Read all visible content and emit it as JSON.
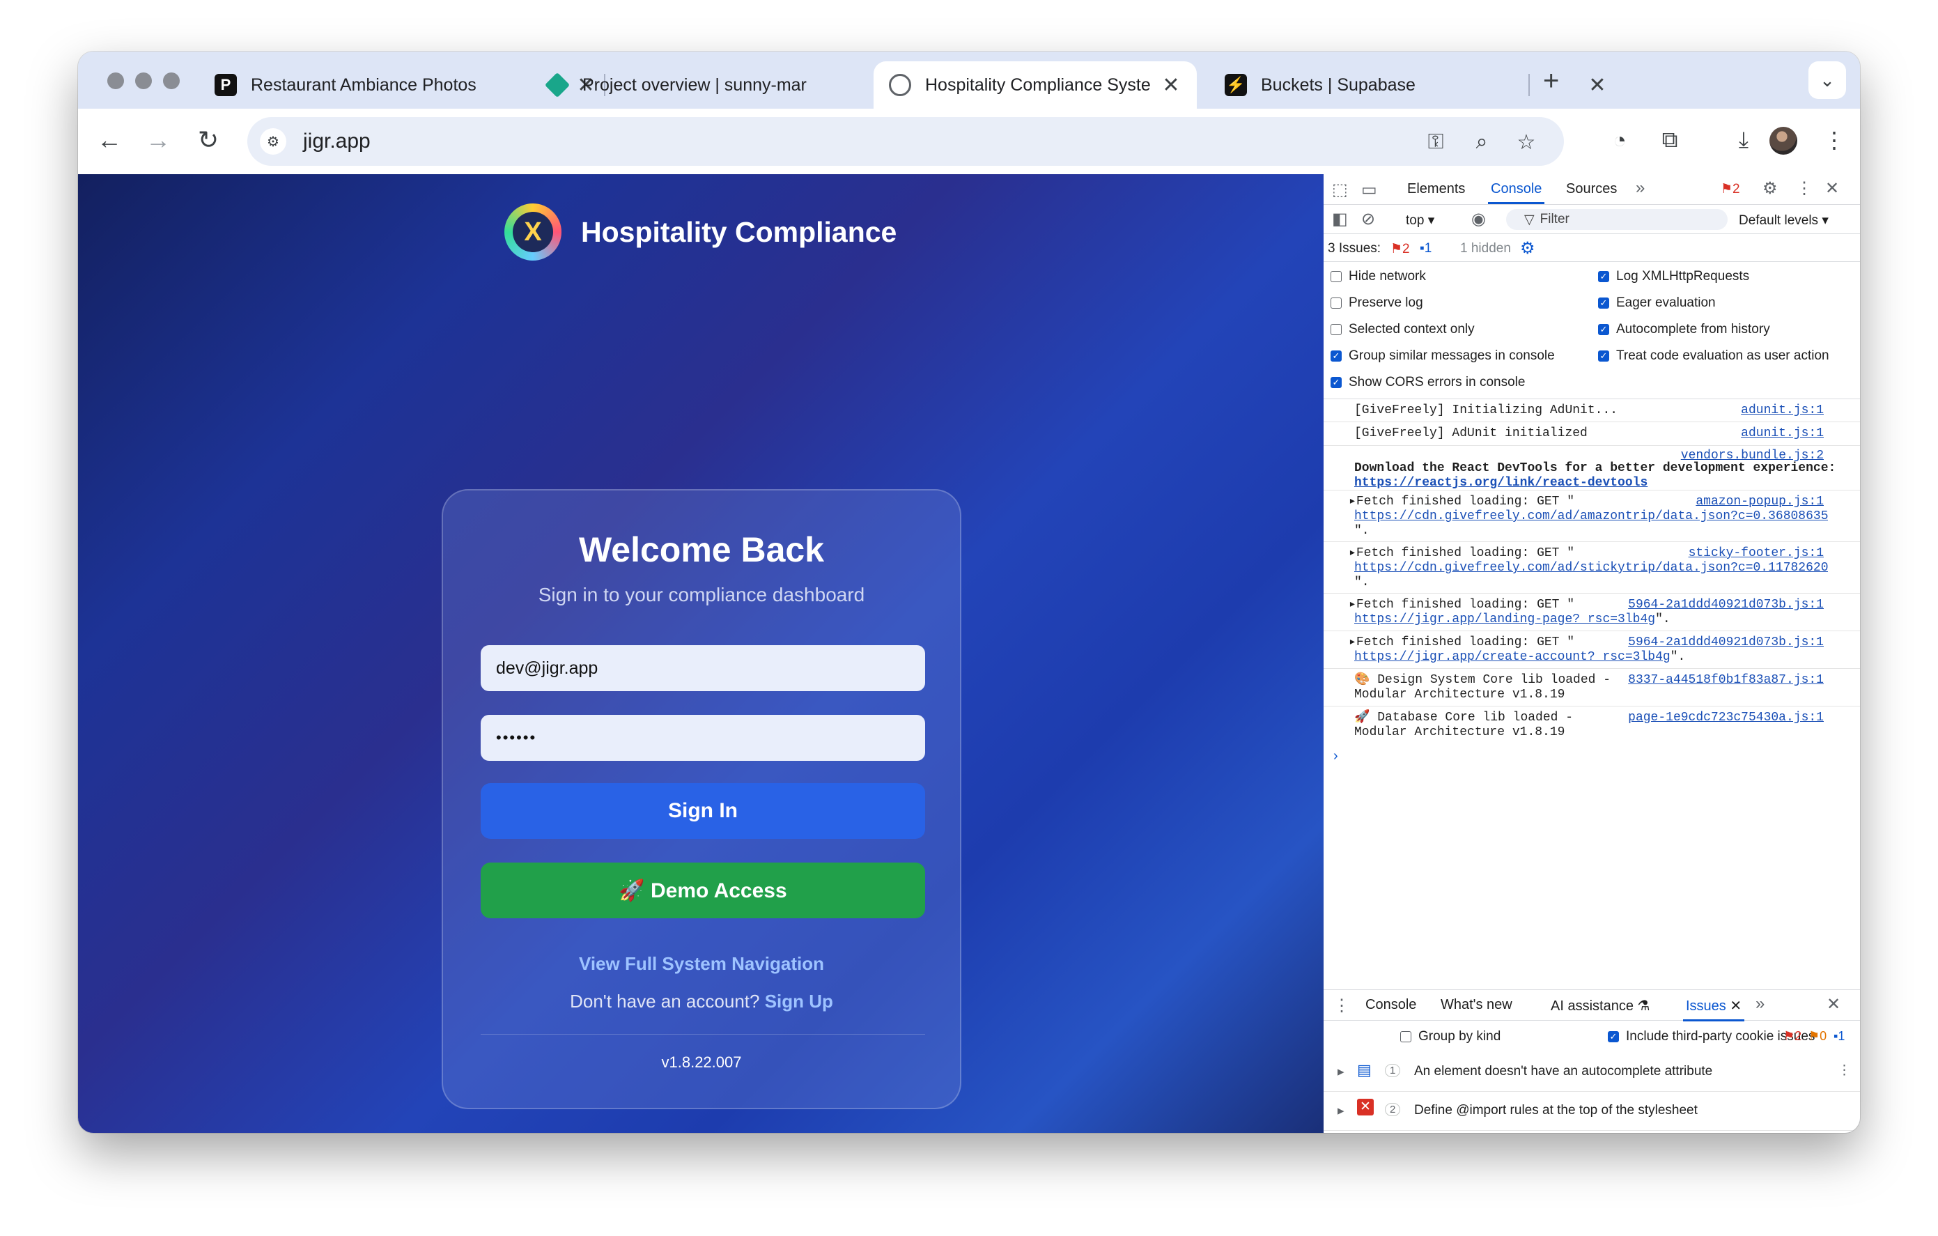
{
  "browser": {
    "tabs": [
      {
        "title": "Restaurant Ambiance Photos",
        "favicon": "p-logo-icon",
        "color": "#111111"
      },
      {
        "title": "Project overview | sunny-mar",
        "favicon": "diamond-icon",
        "color": "#19a68a"
      },
      {
        "title": "Hospitality Compliance Syste",
        "favicon": "globe-icon",
        "color": "#5f6368"
      },
      {
        "title": "Buckets | Supabase",
        "favicon": "supabase-icon",
        "color": "#1f8f4e"
      }
    ],
    "url": "jigr.app"
  },
  "app": {
    "brand": "Hospitality Compliance",
    "welcome": "Welcome Back",
    "subtitle": "Sign in to your compliance dashboard",
    "email_value": "dev@jigr.app",
    "password_value": "••••••",
    "sign_in": "Sign In",
    "demo": "🚀 Demo Access",
    "view_nav": "View Full System Navigation",
    "no_account": "Don't have an account?",
    "sign_up": "Sign Up",
    "version": "v1.8.22.007"
  },
  "devtools": {
    "tabs": [
      "Elements",
      "Console",
      "Sources"
    ],
    "error_count": "2",
    "context": "top",
    "filter": "Filter",
    "levels": "Default levels",
    "issues_label": "3 Issues:",
    "issues_err": "2",
    "issues_info": "1",
    "hidden": "1 hidden",
    "settings_left": [
      "Hide network",
      "Preserve log",
      "Selected context only",
      "Group similar messages in console",
      "Show CORS errors in console"
    ],
    "settings_right": [
      "Log XMLHttpRequests",
      "Eager evaluation",
      "Autocomplete from history",
      "Treat code evaluation as user action"
    ],
    "logs": [
      {
        "msg": "[GiveFreely] Initializing AdUnit...",
        "src": "adunit.js:1"
      },
      {
        "msg": "[GiveFreely] AdUnit initialized",
        "src": "adunit.js:1"
      },
      {
        "msg": "Download the React DevTools for a better development experience:",
        "link": "https://reactjs.org/link/react-devtools",
        "src": "vendors.bundle.js:2"
      },
      {
        "msg": "▸Fetch finished loading: GET \"",
        "link": "https://cdn.givefreely.com/ad/amazontrip/data.json?c=0.36808635…",
        "tail": "\".",
        "src": "amazon-popup.js:1"
      },
      {
        "msg": "▸Fetch finished loading: GET \"",
        "link": "https://cdn.givefreely.com/ad/stickytrip/data.json?c=0.11782620…",
        "tail": "\".",
        "src": "sticky-footer.js:1"
      },
      {
        "msg": "▸Fetch finished loading: GET \"",
        "link": "https://jigr.app/landing-page?_rsc=3lb4g",
        "tail": "\".",
        "src": "5964-2a1ddd40921d073b.js:1"
      },
      {
        "msg": "▸Fetch finished loading: GET \"",
        "link": "https://jigr.app/create-account?_rsc=3lb4g",
        "tail": "\".",
        "src": "5964-2a1ddd40921d073b.js:1"
      },
      {
        "msg": "🎨 Design System Core lib loaded -",
        "line2": "Modular Architecture v1.8.19",
        "src": "8337-a44518f0b1f83a87.js:1"
      },
      {
        "msg": "🚀 Database Core lib loaded -",
        "line2": "Modular Architecture v1.8.19",
        "src": "page-1e9cdc723c75430a.js:1"
      }
    ],
    "drawer_tabs": [
      "Console",
      "What's new",
      "AI assistance",
      "Issues"
    ],
    "group_by_kind": "Group by kind",
    "third_party": "Include third-party cookie issues",
    "counts": {
      "err": "2",
      "warn": "0",
      "info": "1"
    },
    "issues": [
      {
        "count": "1",
        "text": "An element doesn't have an autocomplete attribute"
      },
      {
        "count": "2",
        "text": "Define @import rules at the top of the stylesheet"
      }
    ]
  }
}
